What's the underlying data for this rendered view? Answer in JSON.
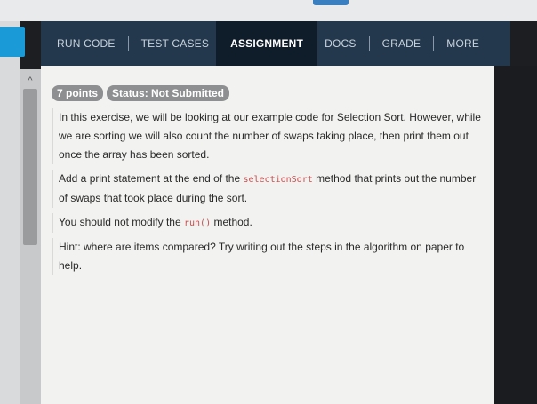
{
  "nav": {
    "tabs": [
      {
        "label": "RUN CODE"
      },
      {
        "label": "TEST CASES"
      },
      {
        "label": "ASSIGNMENT"
      },
      {
        "label": "DOCS"
      },
      {
        "label": "GRADE"
      },
      {
        "label": "MORE"
      }
    ],
    "active": "ASSIGNMENT"
  },
  "badges": {
    "points": "7 points",
    "status": "Status: Not Submitted"
  },
  "content": {
    "p1": "In this exercise, we will be looking at our example code for Selection Sort. However, while we are sorting we will also count the number of swaps taking place, then print them out once the array has been sorted.",
    "p2_before": "Add a print statement at the end of the ",
    "p2_code": "selectionSort",
    "p2_after": " method that prints out the number of swaps that took place during the sort.",
    "p3_before": "You should not modify the ",
    "p3_code": "run()",
    "p3_after": " method.",
    "p4": "Hint: where are items compared? Try writing out the steps in the algorithm on paper to help."
  },
  "icons": {
    "scroll_up": "chevron-up-icon"
  }
}
